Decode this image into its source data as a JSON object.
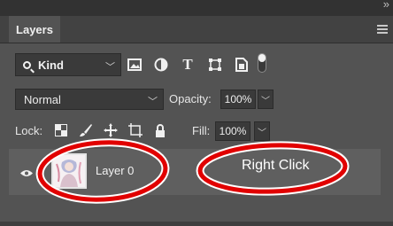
{
  "panel": {
    "tab_label": "Layers",
    "collapse_glyph": "»",
    "menu_icon": "hamburger-icon"
  },
  "filter": {
    "kind_label": "Kind",
    "icons": [
      "image-filter-icon",
      "adjustment-filter-icon",
      "type-filter-icon",
      "shape-filter-icon",
      "smart-object-filter-icon"
    ],
    "type_glyph": "T"
  },
  "blend": {
    "mode": "Normal",
    "opacity_label": "Opacity:",
    "opacity_value": "100%"
  },
  "lock": {
    "label": "Lock:",
    "icons": [
      "lock-transparent-pixels-icon",
      "lock-image-pixels-icon",
      "lock-position-icon",
      "lock-artboard-icon",
      "lock-all-icon"
    ],
    "fill_label": "Fill:",
    "fill_value": "100%"
  },
  "layer": {
    "name": "Layer 0",
    "visible": true
  },
  "annotation": {
    "right_click_text": "Right Click",
    "circle_color": "#e10000"
  }
}
